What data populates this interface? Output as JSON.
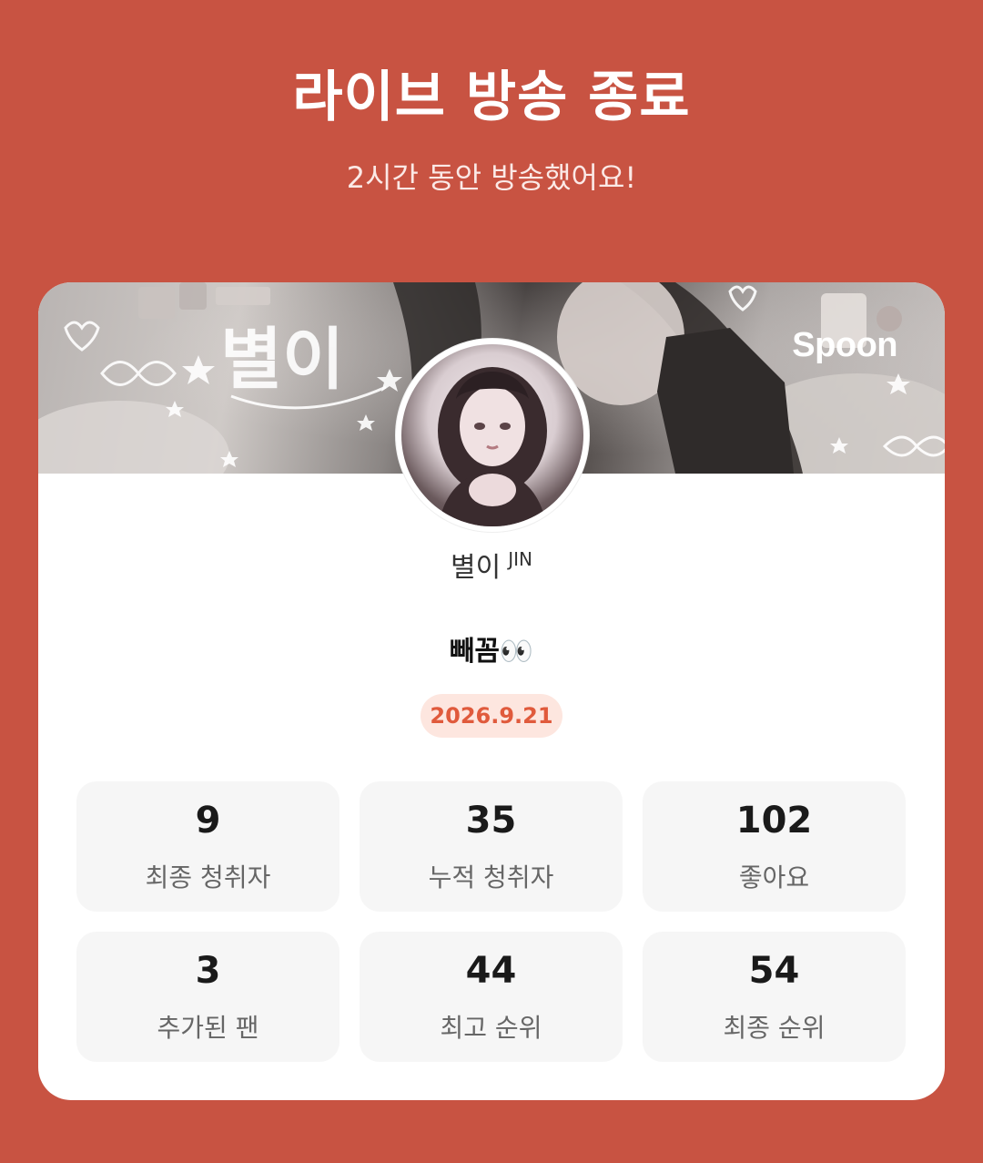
{
  "header": {
    "title": "라이브 방송 종료",
    "subtitle": "2시간 동안 방송했어요!"
  },
  "banner": {
    "logo_text": "Spoon",
    "decor_text": "별이"
  },
  "profile": {
    "username": "별이",
    "username_tag": "JIN"
  },
  "broadcast": {
    "title": "빼꼼👀",
    "date": "2026.9.21"
  },
  "stats": [
    {
      "value": "9",
      "label": "최종 청취자"
    },
    {
      "value": "35",
      "label": "누적 청취자"
    },
    {
      "value": "102",
      "label": "좋아요"
    },
    {
      "value": "3",
      "label": "추가된 팬"
    },
    {
      "value": "44",
      "label": "최고 순위"
    },
    {
      "value": "54",
      "label": "최종 순위"
    }
  ],
  "colors": {
    "background": "#c85342",
    "accent": "#e05a3c",
    "badge_bg": "#fde6df"
  }
}
